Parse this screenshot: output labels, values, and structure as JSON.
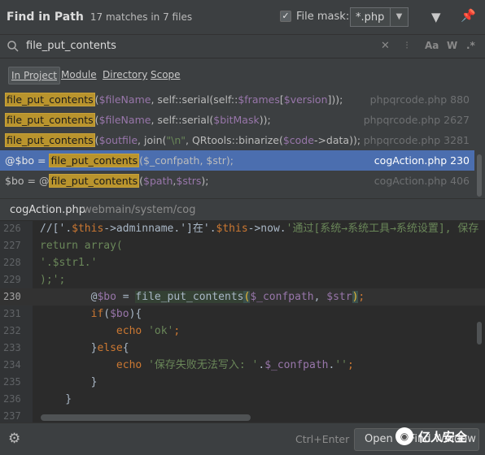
{
  "header": {
    "title": "Find in Path",
    "matches": "17 matches in 7 files",
    "file_mask_checked": "✓",
    "file_mask_label": "File mask:",
    "file_mask_value": "*.php",
    "filter_icon": "filter-icon",
    "pin_icon": "pin-icon"
  },
  "search": {
    "query": "file_put_contents",
    "regex_toggle": ".*",
    "case_toggle": "Aa",
    "word_toggle": "W"
  },
  "scopes": [
    {
      "label": "In Project",
      "active": true
    },
    {
      "label": "Module",
      "active": false
    },
    {
      "label": "Directory",
      "active": false
    },
    {
      "label": "Scope",
      "active": false
    }
  ],
  "results": [
    {
      "before": "",
      "match": "file_put_contents",
      "after_parts": [
        {
          "t": "(",
          "c": "n"
        },
        {
          "t": "$fileName",
          "c": "v"
        },
        {
          "t": ", self::serial(self::",
          "c": "n"
        },
        {
          "t": "$frames",
          "c": "v"
        },
        {
          "t": "[",
          "c": "n"
        },
        {
          "t": "$version",
          "c": "v"
        },
        {
          "t": "]));",
          "c": "n"
        }
      ],
      "file": "phpqrcode.php 880"
    },
    {
      "before": "",
      "match": "file_put_contents",
      "after_parts": [
        {
          "t": "(",
          "c": "n"
        },
        {
          "t": "$fileName",
          "c": "v"
        },
        {
          "t": ", self::serial(",
          "c": "n"
        },
        {
          "t": "$bitMask",
          "c": "v"
        },
        {
          "t": "));",
          "c": "n"
        }
      ],
      "file": "phpqrcode.php 2627"
    },
    {
      "before": "",
      "match": "file_put_contents",
      "after_parts": [
        {
          "t": "(",
          "c": "n"
        },
        {
          "t": "$outfile",
          "c": "v"
        },
        {
          "t": ", join(",
          "c": "n"
        },
        {
          "t": "\"\\n\"",
          "c": "s"
        },
        {
          "t": ", QRtools::binarize(",
          "c": "n"
        },
        {
          "t": "$code",
          "c": "v"
        },
        {
          "t": "->data));",
          "c": "n"
        }
      ],
      "file": "phpqrcode.php 3281"
    },
    {
      "before": "@$bo = ",
      "match": "file_put_contents",
      "after_parts": [
        {
          "t": "($_confpath, $str);",
          "c": "n"
        }
      ],
      "file": "cogAction.php 230",
      "selected": true
    },
    {
      "before": "$bo = @",
      "match": "file_put_contents",
      "after_parts": [
        {
          "t": "(",
          "c": "n"
        },
        {
          "t": "$path",
          "c": "v"
        },
        {
          "t": ",",
          "c": "n"
        },
        {
          "t": "$strs",
          "c": "v"
        },
        {
          "t": ");",
          "c": "n"
        }
      ],
      "file": "cogAction.php 406"
    }
  ],
  "preview": {
    "file": "cogAction.php",
    "dir": "webmain/system/cog"
  },
  "code_lines": [
    {
      "n": "226",
      "indent": 0,
      "parts": [
        {
          "t": "//['",
          "c": "plain"
        },
        {
          "t": ".",
          "c": "plain"
        },
        {
          "t": "$this",
          "c": "kw"
        },
        {
          "t": "->adminname.",
          "c": "plain"
        },
        {
          "t": "']在'",
          "c": "plain"
        },
        {
          "t": ".",
          "c": "plain"
        },
        {
          "t": "$this",
          "c": "kw"
        },
        {
          "t": "->now.",
          "c": "plain"
        },
        {
          "t": "'通过[系统→系统工具→系统设置], 保存",
          "c": "str"
        }
      ]
    },
    {
      "n": "227",
      "indent": 0,
      "parts": [
        {
          "t": "return array(",
          "c": "str"
        }
      ]
    },
    {
      "n": "228",
      "indent": 0,
      "parts": [
        {
          "t": "'.$str1.'",
          "c": "str"
        }
      ]
    },
    {
      "n": "229",
      "indent": 0,
      "parts": [
        {
          "t": ");';",
          "c": "str"
        }
      ]
    },
    {
      "n": "230",
      "indent": 0,
      "cur": true,
      "parts": [
        {
          "t": "        @",
          "c": "plain"
        },
        {
          "t": "$bo",
          "c": "var"
        },
        {
          "t": " = ",
          "c": "plain"
        },
        {
          "t": "file_put_contents",
          "c": "fn"
        },
        {
          "t": "(",
          "c": "brk"
        },
        {
          "t": "$_confpath",
          "c": "var"
        },
        {
          "t": ", ",
          "c": "plain"
        },
        {
          "t": "$str",
          "c": "var"
        },
        {
          "t": ")",
          "c": "brk"
        },
        {
          "t": ";",
          "c": "kw"
        }
      ]
    },
    {
      "n": "231",
      "indent": 0,
      "parts": [
        {
          "t": "        if",
          "c": "kw"
        },
        {
          "t": "(",
          "c": "plain"
        },
        {
          "t": "$bo",
          "c": "var"
        },
        {
          "t": "){",
          "c": "plain"
        }
      ]
    },
    {
      "n": "232",
      "indent": 0,
      "parts": [
        {
          "t": "            echo ",
          "c": "kw"
        },
        {
          "t": "'ok'",
          "c": "str"
        },
        {
          "t": ";",
          "c": "kw"
        }
      ]
    },
    {
      "n": "233",
      "indent": 0,
      "parts": [
        {
          "t": "        }",
          "c": "plain"
        },
        {
          "t": "else",
          "c": "kw"
        },
        {
          "t": "{",
          "c": "plain"
        }
      ]
    },
    {
      "n": "234",
      "indent": 0,
      "parts": [
        {
          "t": "            echo ",
          "c": "kw"
        },
        {
          "t": "'保存失败无法写入: '",
          "c": "str"
        },
        {
          "t": ".",
          "c": "plain"
        },
        {
          "t": "$_confpath",
          "c": "var"
        },
        {
          "t": ".",
          "c": "plain"
        },
        {
          "t": "''",
          "c": "str"
        },
        {
          "t": ";",
          "c": "kw"
        }
      ]
    },
    {
      "n": "235",
      "indent": 0,
      "parts": [
        {
          "t": "        }",
          "c": "plain"
        }
      ]
    },
    {
      "n": "236",
      "indent": 0,
      "parts": [
        {
          "t": "    }",
          "c": "plain"
        }
      ]
    },
    {
      "n": "237",
      "indent": 0,
      "parts": [
        {
          "t": "",
          "c": "plain"
        }
      ]
    }
  ],
  "footer": {
    "shortcut": "Ctrl+Enter",
    "open_button": "Open in Find Window",
    "watermark": "亿人安全"
  },
  "colors": {
    "match_highlight": "#b9942d",
    "selection": "#4b6eaf",
    "background": "#2b2b2b",
    "panel": "#3c3f41"
  }
}
